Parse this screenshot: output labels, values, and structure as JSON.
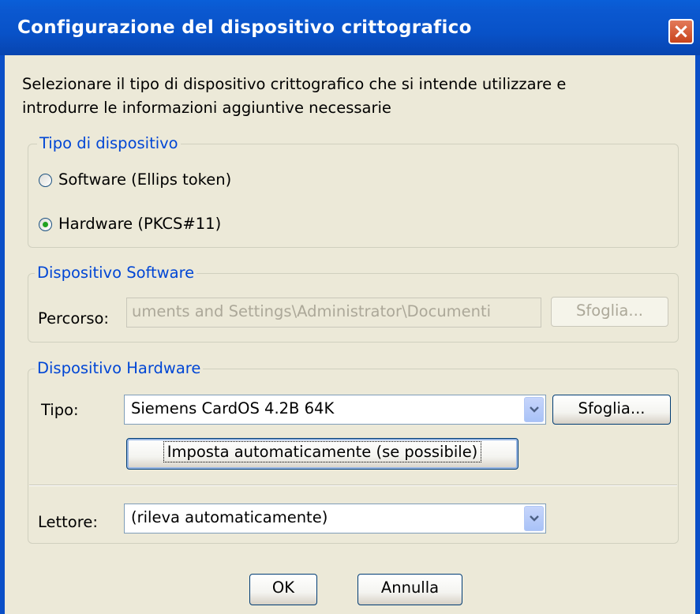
{
  "window": {
    "title": "Configurazione del dispositivo crittografico",
    "close_icon": "close-icon",
    "colors": {
      "titlebar": "#0852c8",
      "close": "#d25a35",
      "background": "#ece9d8",
      "legend_text": "#0046d5"
    }
  },
  "intro": {
    "line1": "Selezionare il tipo di dispositivo crittografico che si intende utilizzare e",
    "line2": "introdurre le informazioni aggiuntive necessarie"
  },
  "device_type": {
    "legend": "Tipo di dispositivo",
    "options": [
      {
        "label": "Software (Ellips token)",
        "checked": false
      },
      {
        "label": "Hardware (PKCS#11)",
        "checked": true
      }
    ]
  },
  "software": {
    "legend": "Dispositivo Software",
    "path_label": "Percorso:",
    "path_value": "uments and Settings\\Administrator\\Documenti",
    "browse_label": "Sfoglia..."
  },
  "hardware": {
    "legend": "Dispositivo Hardware",
    "type_label": "Tipo:",
    "type_value": "Siemens CardOS 4.2B 64K",
    "browse_label": "Sfoglia...",
    "auto_label": "Imposta automaticamente (se possibile)",
    "reader_label": "Lettore:",
    "reader_value": "(rileva automaticamente)"
  },
  "footer": {
    "ok_label": "OK",
    "cancel_label": "Annulla"
  }
}
